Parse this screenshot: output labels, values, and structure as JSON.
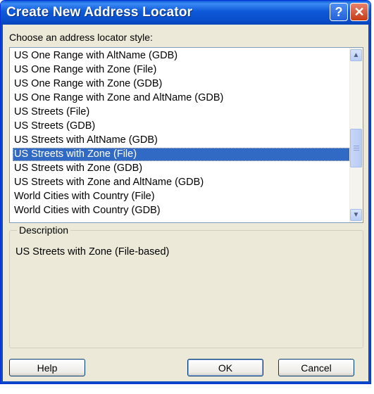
{
  "window": {
    "title": "Create New Address Locator",
    "help_glyph": "?",
    "close_glyph": "✕"
  },
  "prompt": "Choose an address locator style:",
  "styles": [
    "US One Range with AltName (GDB)",
    "US One Range with Zone (File)",
    "US One Range with Zone (GDB)",
    "US One Range with Zone and AltName (GDB)",
    "US Streets (File)",
    "US Streets (GDB)",
    "US Streets with AltName (GDB)",
    "US Streets with Zone (File)",
    "US Streets with Zone (GDB)",
    "US Streets with Zone and AltName (GDB)",
    "World Cities with Country (File)",
    "World Cities with Country (GDB)"
  ],
  "selected_index": 7,
  "description": {
    "legend": "Description",
    "text": "US Streets with Zone (File-based)"
  },
  "buttons": {
    "help": "Help",
    "ok": "OK",
    "cancel": "Cancel"
  },
  "colors": {
    "titlebar": "#0a4fcb",
    "selection": "#316ac5",
    "dialog_bg": "#ece9d8"
  }
}
